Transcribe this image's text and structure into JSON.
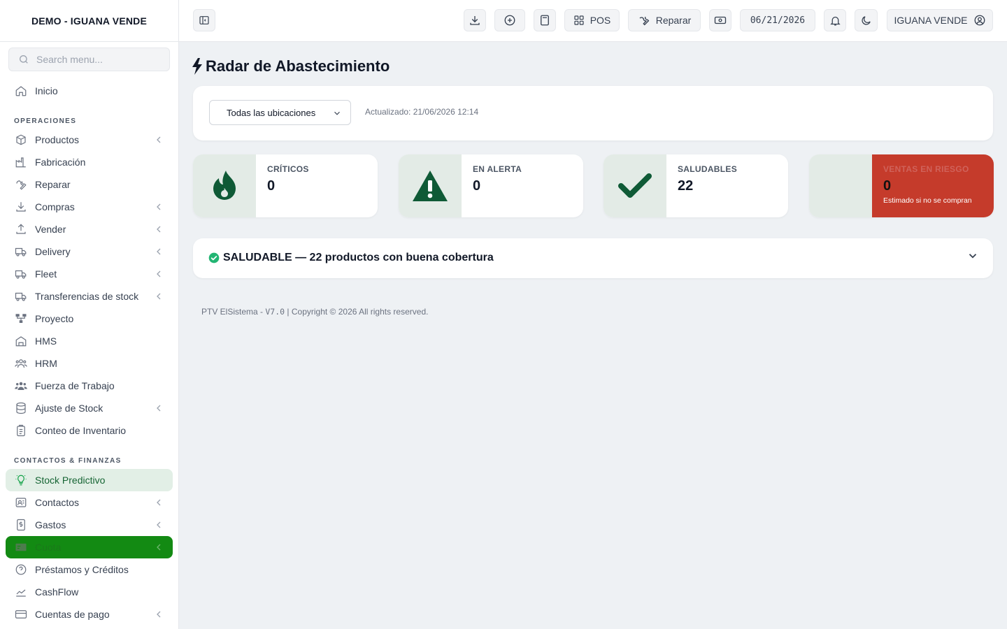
{
  "sidebar": {
    "brand": "DEMO - IGUANA VENDE",
    "search_placeholder": "Search menu...",
    "home": "Inicio",
    "sections": {
      "ops": "OPERACIONES",
      "contacts": "CONTACTOS & FINANZAS"
    },
    "items": {
      "productos": "Productos",
      "fabricacion": "Fabricación",
      "reparar": "Reparar",
      "compras": "Compras",
      "vender": "Vender",
      "delivery": "Delivery",
      "fleet": "Fleet",
      "transferencias": "Transferencias de stock",
      "proyecto": "Proyecto",
      "hms": "HMS",
      "hrm": "HRM",
      "fuerza": "Fuerza de Trabajo",
      "ajuste": "Ajuste de Stock",
      "conteo": "Conteo de Inventario",
      "stock_predictivo": "Stock Predictivo",
      "contactos": "Contactos",
      "gastos": "Gastos",
      "cuota": "Cuota",
      "prestamos": "Préstamos y Créditos",
      "cashflow": "CashFlow",
      "cuentas": "Cuentas de pago"
    },
    "active_item": "Stock Predictivo"
  },
  "topbar": {
    "pos_label": "POS",
    "repair_label": "Reparar",
    "date": "06/21/2026",
    "user_label": "IGUANA VENDE"
  },
  "main": {
    "title": "Radar de Abastecimiento",
    "location_select": "Todas las ubicaciones",
    "updated": "Actualizado: 21/06/2026 12:14",
    "cards": {
      "criticos": {
        "label": "CRÍTICOS",
        "value": "0"
      },
      "alerta": {
        "label": "EN ALERTA",
        "value": "0"
      },
      "saludables": {
        "label": "SALUDABLES",
        "value": "22"
      },
      "riesgo": {
        "label": "VENTAS EN RIESGO",
        "value": "0",
        "sub": "Estimado si no se compran"
      }
    },
    "status": "SALUDABLE — 22 productos con buena cobertura",
    "footer_prefix": "PTV ElSistema - ",
    "footer_version": "V7.0",
    "footer_suffix": " | Copyright © 2026 All rights reserved."
  },
  "colors": {
    "accent_green": "#0f5a36",
    "active_bg": "#e2efe6",
    "risk_red": "#c53b2b",
    "highlight_green": "#138a13"
  }
}
